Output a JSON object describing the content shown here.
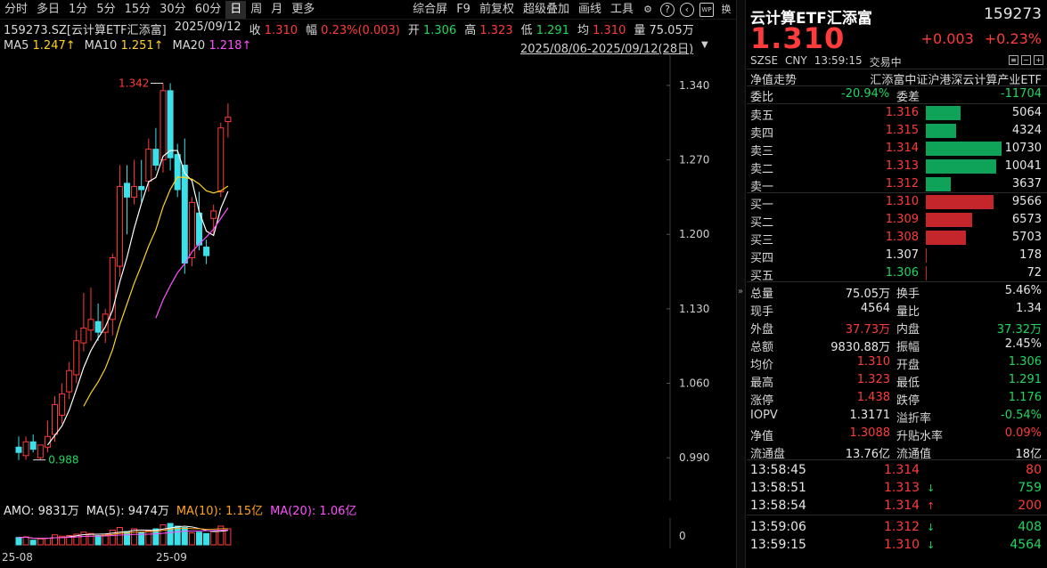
{
  "toolbar": {
    "left": [
      "分时",
      "多日",
      "1分",
      "5分",
      "15分",
      "30分",
      "60分",
      "日",
      "周",
      "月",
      "更多"
    ],
    "active": "日",
    "right": [
      "综合屏",
      "F9",
      "前复权",
      "超级叠加",
      "画线",
      "工具"
    ]
  },
  "info": {
    "code": "159273.SZ[云计算ETF汇添富]",
    "date": "2025/09/12",
    "close_l": "收",
    "close": "1.310",
    "amp_l": "幅",
    "amp": "0.23%(0.003)",
    "open_l": "开",
    "open": "1.306",
    "high_l": "高",
    "high": "1.323",
    "low_l": "低",
    "low": "1.291",
    "avg_l": "均",
    "avg": "1.310",
    "vol_l": "量",
    "vol": "75.05万"
  },
  "ma": {
    "ma5_l": "MA5",
    "ma5": "1.247↑",
    "ma10_l": "MA10",
    "ma10": "1.251↑",
    "ma20_l": "MA20",
    "ma20": "1.218↑"
  },
  "range": "2025/08/06-2025/09/12(28日)",
  "y_ticks": [
    "1.340",
    "1.270",
    "1.200",
    "1.130",
    "1.060",
    "0.990"
  ],
  "annot_high": "1.342",
  "annot_low": "0.988",
  "amo": {
    "label": "AMO: 9831万",
    "ma5": "MA(5): 9474万",
    "ma10": "MA(10): 1.15亿",
    "ma20": "MA(20): 1.06亿"
  },
  "vol_zero": "0",
  "x_labels": [
    "25-08",
    "25-09"
  ],
  "chart_data": {
    "type": "candlestick",
    "ylim": [
      0.95,
      1.36
    ],
    "candles": [
      {
        "o": 1.0,
        "h": 1.01,
        "l": 0.988,
        "c": 0.995
      },
      {
        "o": 0.992,
        "h": 1.01,
        "l": 0.988,
        "c": 1.005
      },
      {
        "o": 1.005,
        "h": 1.012,
        "l": 0.995,
        "c": 0.998
      },
      {
        "o": 0.99,
        "h": 1.002,
        "l": 0.988,
        "c": 1.002
      },
      {
        "o": 1.0,
        "h": 1.025,
        "l": 0.995,
        "c": 1.01
      },
      {
        "o": 1.012,
        "h": 1.048,
        "l": 1.005,
        "c": 1.04
      },
      {
        "o": 1.03,
        "h": 1.06,
        "l": 1.022,
        "c": 1.05
      },
      {
        "o": 1.052,
        "h": 1.08,
        "l": 1.045,
        "c": 1.072
      },
      {
        "o": 1.068,
        "h": 1.11,
        "l": 1.06,
        "c": 1.1
      },
      {
        "o": 1.098,
        "h": 1.145,
        "l": 1.09,
        "c": 1.112
      },
      {
        "o": 1.11,
        "h": 1.15,
        "l": 1.1,
        "c": 1.12
      },
      {
        "o": 1.118,
        "h": 1.135,
        "l": 1.1,
        "c": 1.108
      },
      {
        "o": 1.108,
        "h": 1.13,
        "l": 1.098,
        "c": 1.125
      },
      {
        "o": 1.12,
        "h": 1.182,
        "l": 1.105,
        "c": 1.178
      },
      {
        "o": 1.17,
        "h": 1.265,
        "l": 1.16,
        "c": 1.245
      },
      {
        "o": 1.248,
        "h": 1.265,
        "l": 1.2,
        "c": 1.235
      },
      {
        "o": 1.235,
        "h": 1.27,
        "l": 1.228,
        "c": 1.245
      },
      {
        "o": 1.245,
        "h": 1.27,
        "l": 1.23,
        "c": 1.242
      },
      {
        "o": 1.25,
        "h": 1.29,
        "l": 1.24,
        "c": 1.28
      },
      {
        "o": 1.28,
        "h": 1.3,
        "l": 1.26,
        "c": 1.265
      },
      {
        "o": 1.27,
        "h": 1.342,
        "l": 1.258,
        "c": 1.335
      },
      {
        "o": 1.335,
        "h": 1.342,
        "l": 1.26,
        "c": 1.272
      },
      {
        "o": 1.275,
        "h": 1.285,
        "l": 1.235,
        "c": 1.242
      },
      {
        "o": 1.265,
        "h": 1.29,
        "l": 1.163,
        "c": 1.173
      },
      {
        "o": 1.178,
        "h": 1.235,
        "l": 1.17,
        "c": 1.23
      },
      {
        "o": 1.22,
        "h": 1.24,
        "l": 1.185,
        "c": 1.19
      },
      {
        "o": 1.188,
        "h": 1.195,
        "l": 1.172,
        "c": 1.18
      },
      {
        "o": 1.215,
        "h": 1.228,
        "l": 1.2,
        "c": 1.222
      },
      {
        "o": 1.24,
        "h": 1.305,
        "l": 1.235,
        "c": 1.3
      },
      {
        "o": 1.306,
        "h": 1.323,
        "l": 1.291,
        "c": 1.31
      }
    ],
    "vol": [
      55,
      60,
      35,
      45,
      50,
      75,
      65,
      70,
      80,
      95,
      85,
      70,
      80,
      110,
      130,
      100,
      120,
      95,
      105,
      120,
      150,
      160,
      140,
      130,
      90,
      95,
      85,
      100,
      140,
      120
    ],
    "ma5_start": 4,
    "ma10_start": 9,
    "ma20_start": 19
  },
  "right": {
    "name": "云计算ETF汇添富",
    "code": "159273",
    "price": "1.310",
    "chg": "+0.003",
    "pct": "+0.23%",
    "market": "SZSE",
    "currency": "CNY",
    "time": "13:59:15",
    "state": "交易中",
    "desc_l": "净值走势",
    "desc": "汇添富中证沪港深云计算产业ETF",
    "weibi_l": "委比",
    "weibi": "-20.94%",
    "weicha_l": "委差",
    "weicha": "-11704",
    "asks": [
      {
        "l": "卖五",
        "p": "1.316",
        "v": "5064",
        "w": 0.43
      },
      {
        "l": "卖四",
        "p": "1.315",
        "v": "4324",
        "w": 0.37
      },
      {
        "l": "卖三",
        "p": "1.314",
        "v": "10730",
        "w": 0.93
      },
      {
        "l": "卖二",
        "p": "1.313",
        "v": "10041",
        "w": 0.87
      },
      {
        "l": "卖一",
        "p": "1.312",
        "v": "3637",
        "w": 0.31
      }
    ],
    "bids": [
      {
        "l": "买一",
        "p": "1.310",
        "v": "9566",
        "w": 0.83
      },
      {
        "l": "买二",
        "p": "1.309",
        "v": "6573",
        "w": 0.57
      },
      {
        "l": "买三",
        "p": "1.308",
        "v": "5703",
        "w": 0.49
      },
      {
        "l": "买四",
        "p": "1.307",
        "v": "178",
        "w": 0.015
      },
      {
        "l": "买五",
        "p": "1.306",
        "v": "72",
        "w": 0.006
      }
    ],
    "stats": [
      {
        "a": "总量",
        "av": "75.05万",
        "ac": "white",
        "b": "换手",
        "bv": "5.46%",
        "bc": "white"
      },
      {
        "a": "现手",
        "av": "4564",
        "ac": "white",
        "b": "量比",
        "bv": "1.34",
        "bc": "white"
      },
      {
        "a": "外盘",
        "av": "37.73万",
        "ac": "red",
        "b": "内盘",
        "bv": "37.32万",
        "bc": "green"
      },
      {
        "a": "总额",
        "av": "9830.88万",
        "ac": "white",
        "b": "振幅",
        "bv": "2.45%",
        "bc": "white"
      },
      {
        "a": "均价",
        "av": "1.310",
        "ac": "red",
        "b": "开盘",
        "bv": "1.306",
        "bc": "green"
      },
      {
        "a": "最高",
        "av": "1.323",
        "ac": "red",
        "b": "最低",
        "bv": "1.291",
        "bc": "green"
      },
      {
        "a": "涨停",
        "av": "1.438",
        "ac": "red",
        "b": "跌停",
        "bv": "1.176",
        "bc": "green"
      },
      {
        "a": "IOPV",
        "av": "1.3171",
        "ac": "white",
        "b": "溢折率",
        "bv": "-0.54%",
        "bc": "green"
      },
      {
        "a": "净值",
        "av": "1.3088",
        "ac": "red",
        "b": "升贴水率",
        "bv": "0.09%",
        "bc": "red"
      },
      {
        "a": "流通盘",
        "av": "13.76亿",
        "ac": "white",
        "b": "流通值",
        "bv": "18亿",
        "bc": "white"
      }
    ],
    "ticks": [
      {
        "t": "13:58:45",
        "p": "1.314",
        "arrow": "",
        "v": "80"
      },
      {
        "t": "13:58:51",
        "p": "1.313",
        "arrow": "↓",
        "v": "759"
      },
      {
        "t": "13:58:54",
        "p": "1.314",
        "arrow": "↑",
        "v": "200"
      },
      {
        "t": "13:59:06",
        "p": "1.312",
        "arrow": "↓",
        "v": "408"
      },
      {
        "t": "13:59:15",
        "p": "1.310",
        "arrow": "↓",
        "v": "4564"
      }
    ]
  }
}
